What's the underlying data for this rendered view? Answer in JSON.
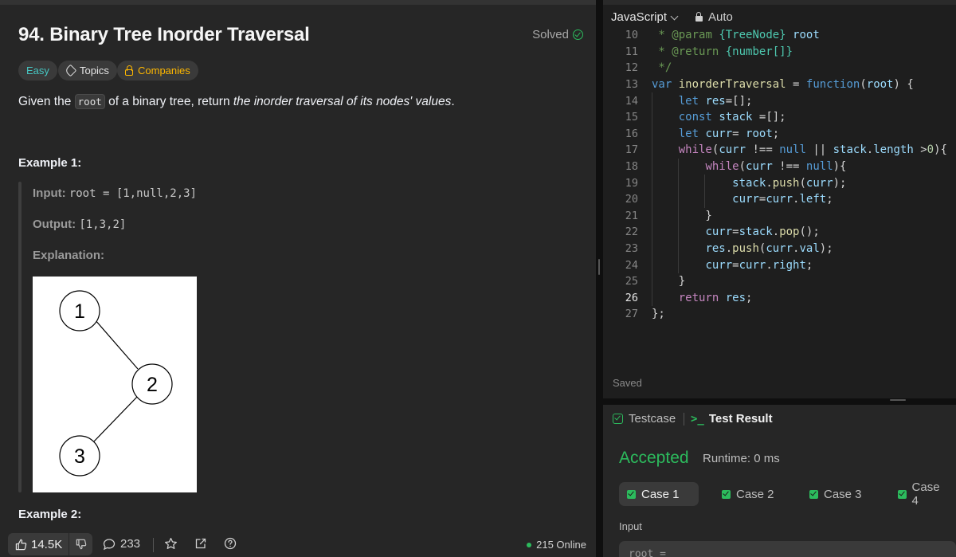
{
  "problem": {
    "title": "94. Binary Tree Inorder Traversal",
    "solved_label": "Solved",
    "tags": {
      "difficulty": "Easy",
      "topics": "Topics",
      "companies": "Companies"
    },
    "description": {
      "before": "Given the ",
      "code": "root",
      "middle": " of a binary tree, return ",
      "emphasis": "the inorder traversal of its nodes' values",
      "after": "."
    },
    "example1": {
      "heading": "Example 1:",
      "input_label": "Input:",
      "input_value": "root = [1,null,2,3]",
      "output_label": "Output:",
      "output_value": "[1,3,2]",
      "explanation_label": "Explanation:",
      "tree_nodes": [
        "1",
        "2",
        "3"
      ]
    },
    "example2": {
      "heading": "Example 2:"
    }
  },
  "footer": {
    "likes": "14.5K",
    "comments": "233",
    "online": "215 Online"
  },
  "editor": {
    "language": "JavaScript",
    "mode": "Auto",
    "saved_label": "Saved",
    "active_line": "26",
    "lines": [
      {
        "num": "10",
        "text": " * @param {TreeNode} root"
      },
      {
        "num": "11",
        "text": " * @return {number[]}"
      },
      {
        "num": "12",
        "text": " */"
      },
      {
        "num": "13",
        "text": "var inorderTraversal = function(root) {"
      },
      {
        "num": "14",
        "text": "    let res=[];"
      },
      {
        "num": "15",
        "text": "    const stack =[];"
      },
      {
        "num": "16",
        "text": "    let curr= root;"
      },
      {
        "num": "17",
        "text": "    while(curr !== null || stack.length >0){"
      },
      {
        "num": "18",
        "text": "        while(curr !== null){"
      },
      {
        "num": "19",
        "text": "            stack.push(curr);"
      },
      {
        "num": "20",
        "text": "            curr=curr.left;"
      },
      {
        "num": "21",
        "text": "        }"
      },
      {
        "num": "22",
        "text": "        curr=stack.pop();"
      },
      {
        "num": "23",
        "text": "        res.push(curr.val);"
      },
      {
        "num": "24",
        "text": "        curr=curr.right;"
      },
      {
        "num": "25",
        "text": "    }"
      },
      {
        "num": "26",
        "text": "    return res;"
      },
      {
        "num": "27",
        "text": "};"
      }
    ]
  },
  "results": {
    "tab_testcase": "Testcase",
    "tab_result": "Test Result",
    "status": "Accepted",
    "runtime": "Runtime: 0 ms",
    "cases": [
      "Case 1",
      "Case 2",
      "Case 3",
      "Case 4"
    ],
    "input_label": "Input",
    "input_value": "root ="
  },
  "colors": {
    "accent_green": "#2cbb5d",
    "easy": "#46c6c2",
    "companies": "#ffb800",
    "panel_bg": "#262626",
    "editor_bg": "#1e1e1e"
  },
  "icons": [
    "check-circle-icon",
    "tag-icon",
    "lock-icon",
    "chevron-down-icon",
    "thumbs-up-icon",
    "thumbs-down-icon",
    "comment-icon",
    "star-icon",
    "share-icon",
    "help-icon",
    "terminal-icon",
    "checkbox-icon"
  ]
}
